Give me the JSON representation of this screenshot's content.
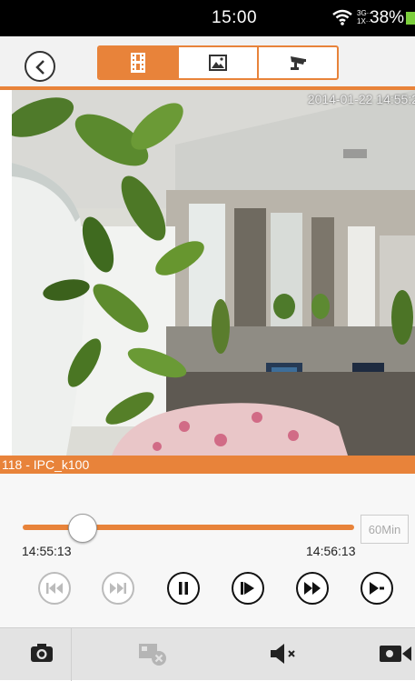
{
  "status_bar": {
    "time": "15:00",
    "network": "3G···\n1X···",
    "battery": "38%"
  },
  "header": {
    "tabs": [
      {
        "icon": "film-icon",
        "active": true
      },
      {
        "icon": "image-icon",
        "active": false
      },
      {
        "icon": "cctv-camera-icon",
        "active": false
      }
    ]
  },
  "video": {
    "timestamp": "2014-01-22 14:55:2",
    "camera_label": "118 - IPC_k100"
  },
  "playback": {
    "progress": 0.18,
    "start_time": "14:55:13",
    "end_time": "14:56:13",
    "duration_label": "60Min"
  },
  "colors": {
    "accent": "#e8833a"
  }
}
